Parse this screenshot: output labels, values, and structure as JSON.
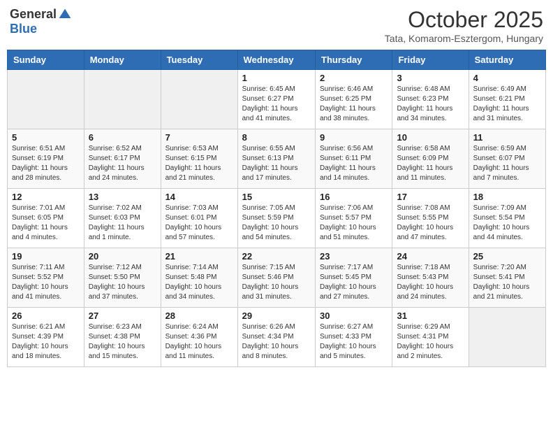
{
  "header": {
    "logo_general": "General",
    "logo_blue": "Blue",
    "month_title": "October 2025",
    "location": "Tata, Komarom-Esztergom, Hungary"
  },
  "weekdays": [
    "Sunday",
    "Monday",
    "Tuesday",
    "Wednesday",
    "Thursday",
    "Friday",
    "Saturday"
  ],
  "weeks": [
    {
      "days": [
        {
          "num": "",
          "info": ""
        },
        {
          "num": "",
          "info": ""
        },
        {
          "num": "",
          "info": ""
        },
        {
          "num": "1",
          "info": "Sunrise: 6:45 AM\nSunset: 6:27 PM\nDaylight: 11 hours\nand 41 minutes."
        },
        {
          "num": "2",
          "info": "Sunrise: 6:46 AM\nSunset: 6:25 PM\nDaylight: 11 hours\nand 38 minutes."
        },
        {
          "num": "3",
          "info": "Sunrise: 6:48 AM\nSunset: 6:23 PM\nDaylight: 11 hours\nand 34 minutes."
        },
        {
          "num": "4",
          "info": "Sunrise: 6:49 AM\nSunset: 6:21 PM\nDaylight: 11 hours\nand 31 minutes."
        }
      ]
    },
    {
      "days": [
        {
          "num": "5",
          "info": "Sunrise: 6:51 AM\nSunset: 6:19 PM\nDaylight: 11 hours\nand 28 minutes."
        },
        {
          "num": "6",
          "info": "Sunrise: 6:52 AM\nSunset: 6:17 PM\nDaylight: 11 hours\nand 24 minutes."
        },
        {
          "num": "7",
          "info": "Sunrise: 6:53 AM\nSunset: 6:15 PM\nDaylight: 11 hours\nand 21 minutes."
        },
        {
          "num": "8",
          "info": "Sunrise: 6:55 AM\nSunset: 6:13 PM\nDaylight: 11 hours\nand 17 minutes."
        },
        {
          "num": "9",
          "info": "Sunrise: 6:56 AM\nSunset: 6:11 PM\nDaylight: 11 hours\nand 14 minutes."
        },
        {
          "num": "10",
          "info": "Sunrise: 6:58 AM\nSunset: 6:09 PM\nDaylight: 11 hours\nand 11 minutes."
        },
        {
          "num": "11",
          "info": "Sunrise: 6:59 AM\nSunset: 6:07 PM\nDaylight: 11 hours\nand 7 minutes."
        }
      ]
    },
    {
      "days": [
        {
          "num": "12",
          "info": "Sunrise: 7:01 AM\nSunset: 6:05 PM\nDaylight: 11 hours\nand 4 minutes."
        },
        {
          "num": "13",
          "info": "Sunrise: 7:02 AM\nSunset: 6:03 PM\nDaylight: 11 hours\nand 1 minute."
        },
        {
          "num": "14",
          "info": "Sunrise: 7:03 AM\nSunset: 6:01 PM\nDaylight: 10 hours\nand 57 minutes."
        },
        {
          "num": "15",
          "info": "Sunrise: 7:05 AM\nSunset: 5:59 PM\nDaylight: 10 hours\nand 54 minutes."
        },
        {
          "num": "16",
          "info": "Sunrise: 7:06 AM\nSunset: 5:57 PM\nDaylight: 10 hours\nand 51 minutes."
        },
        {
          "num": "17",
          "info": "Sunrise: 7:08 AM\nSunset: 5:55 PM\nDaylight: 10 hours\nand 47 minutes."
        },
        {
          "num": "18",
          "info": "Sunrise: 7:09 AM\nSunset: 5:54 PM\nDaylight: 10 hours\nand 44 minutes."
        }
      ]
    },
    {
      "days": [
        {
          "num": "19",
          "info": "Sunrise: 7:11 AM\nSunset: 5:52 PM\nDaylight: 10 hours\nand 41 minutes."
        },
        {
          "num": "20",
          "info": "Sunrise: 7:12 AM\nSunset: 5:50 PM\nDaylight: 10 hours\nand 37 minutes."
        },
        {
          "num": "21",
          "info": "Sunrise: 7:14 AM\nSunset: 5:48 PM\nDaylight: 10 hours\nand 34 minutes."
        },
        {
          "num": "22",
          "info": "Sunrise: 7:15 AM\nSunset: 5:46 PM\nDaylight: 10 hours\nand 31 minutes."
        },
        {
          "num": "23",
          "info": "Sunrise: 7:17 AM\nSunset: 5:45 PM\nDaylight: 10 hours\nand 27 minutes."
        },
        {
          "num": "24",
          "info": "Sunrise: 7:18 AM\nSunset: 5:43 PM\nDaylight: 10 hours\nand 24 minutes."
        },
        {
          "num": "25",
          "info": "Sunrise: 7:20 AM\nSunset: 5:41 PM\nDaylight: 10 hours\nand 21 minutes."
        }
      ]
    },
    {
      "days": [
        {
          "num": "26",
          "info": "Sunrise: 6:21 AM\nSunset: 4:39 PM\nDaylight: 10 hours\nand 18 minutes."
        },
        {
          "num": "27",
          "info": "Sunrise: 6:23 AM\nSunset: 4:38 PM\nDaylight: 10 hours\nand 15 minutes."
        },
        {
          "num": "28",
          "info": "Sunrise: 6:24 AM\nSunset: 4:36 PM\nDaylight: 10 hours\nand 11 minutes."
        },
        {
          "num": "29",
          "info": "Sunrise: 6:26 AM\nSunset: 4:34 PM\nDaylight: 10 hours\nand 8 minutes."
        },
        {
          "num": "30",
          "info": "Sunrise: 6:27 AM\nSunset: 4:33 PM\nDaylight: 10 hours\nand 5 minutes."
        },
        {
          "num": "31",
          "info": "Sunrise: 6:29 AM\nSunset: 4:31 PM\nDaylight: 10 hours\nand 2 minutes."
        },
        {
          "num": "",
          "info": ""
        }
      ]
    }
  ]
}
